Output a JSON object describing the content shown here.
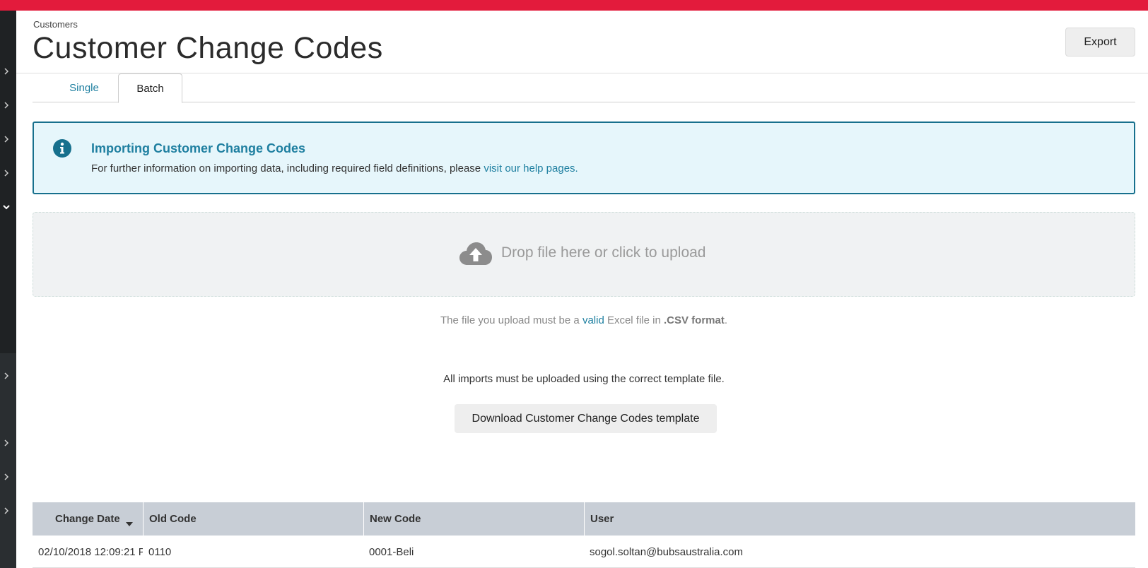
{
  "header": {
    "breadcrumb": "Customers",
    "title": "Customer Change Codes",
    "export_label": "Export"
  },
  "tabs": [
    {
      "label": "Single",
      "active": false
    },
    {
      "label": "Batch",
      "active": true
    }
  ],
  "info": {
    "title": "Importing Customer Change Codes",
    "text": "For further information on importing data, including required field definitions, please ",
    "link": "visit our help pages."
  },
  "upload": {
    "drop_text": "Drop file here or click to upload",
    "note_prefix": "The file you upload must be a ",
    "note_valid": "valid",
    "note_middle": " Excel file in ",
    "note_format": ".CSV format",
    "note_suffix": ".",
    "template_note": "All imports must be uploaded using the correct template file.",
    "download_label": "Download Customer Change Codes template"
  },
  "table": {
    "columns": [
      "Change Date",
      "Old Code",
      "New Code",
      "User"
    ],
    "rows": [
      {
        "date": "02/10/2018 12:09:21 P",
        "old": "0110",
        "new": "0001-Beli",
        "user": "sogol.soltan@bubsaustralia.com"
      }
    ]
  },
  "colors": {
    "topbar": "#e31b3c",
    "accent": "#1e7fa0",
    "sidebar": "#1f2224",
    "info_bg": "#e6f6fb",
    "table_header": "#c8ced6"
  }
}
